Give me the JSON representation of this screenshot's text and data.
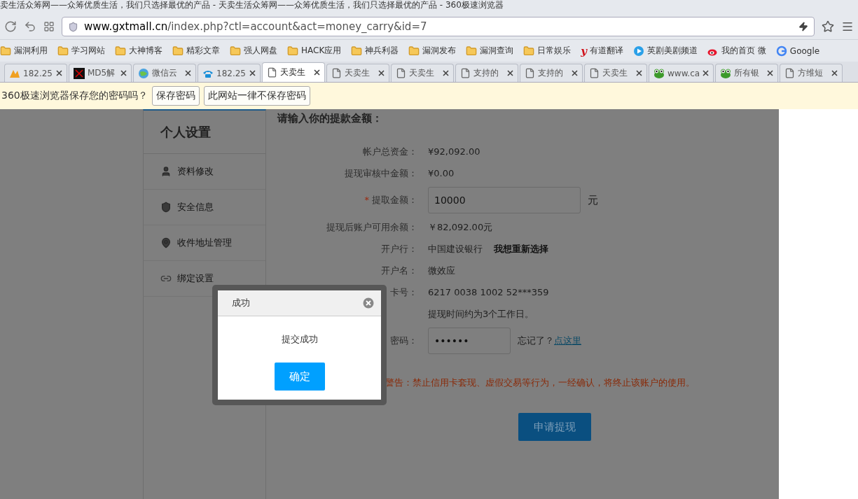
{
  "window": {
    "title": "卖生活众筹网——众筹优质生活，我们只选择最优的产品 - 天卖生活众筹网——众筹优质生活，我们只选择最优的产品 - 360极速浏览器"
  },
  "address_bar": {
    "host": "www.gxtmall.cn",
    "path": "/index.php?ctl=account&act=money_carry&id=7"
  },
  "bookmarks": [
    {
      "kind": "folder",
      "label": "漏洞利用"
    },
    {
      "kind": "folder",
      "label": "学习网站"
    },
    {
      "kind": "folder",
      "label": "大神博客"
    },
    {
      "kind": "folder",
      "label": "精彩文章"
    },
    {
      "kind": "folder",
      "label": "强人网盘"
    },
    {
      "kind": "folder",
      "label": "HACK应用"
    },
    {
      "kind": "folder",
      "label": "神兵利器"
    },
    {
      "kind": "folder",
      "label": "漏洞发布"
    },
    {
      "kind": "folder",
      "label": "漏洞查询"
    },
    {
      "kind": "folder",
      "label": "日常娱乐"
    },
    {
      "kind": "letter",
      "label": "有道翻译",
      "glyph": "y"
    },
    {
      "kind": "play",
      "label": "英剧美剧频道"
    },
    {
      "kind": "eye",
      "label": "我的首页 微"
    },
    {
      "kind": "google",
      "label": "Google"
    }
  ],
  "tabs": [
    {
      "kind": "chart",
      "label": "182.25",
      "selected": false
    },
    {
      "kind": "dark",
      "label": "MD5解",
      "selected": false
    },
    {
      "kind": "globe",
      "label": "微信云",
      "selected": false
    },
    {
      "kind": "phone",
      "label": "182.25",
      "selected": false
    },
    {
      "kind": "page",
      "label": "天卖生",
      "selected": true
    },
    {
      "kind": "page",
      "label": "天卖生",
      "selected": false
    },
    {
      "kind": "page",
      "label": "天卖生",
      "selected": false
    },
    {
      "kind": "page",
      "label": "支持的",
      "selected": false
    },
    {
      "kind": "page",
      "label": "支持的",
      "selected": false
    },
    {
      "kind": "page",
      "label": "天卖生",
      "selected": false
    },
    {
      "kind": "frog",
      "label": "www.ca",
      "selected": false
    },
    {
      "kind": "frog",
      "label": "所有银",
      "selected": false
    },
    {
      "kind": "page",
      "label": "方维短",
      "selected": false
    }
  ],
  "password_bar": {
    "message": "360极速浏览器保存您的密码吗？",
    "buttons": [
      "保存密码",
      "此网站一律不保存密码"
    ]
  },
  "sidebar": {
    "title": "个人设置",
    "items": [
      {
        "kind": "user",
        "label": "资料修改"
      },
      {
        "kind": "shield",
        "label": "安全信息"
      },
      {
        "kind": "pin",
        "label": "收件地址管理"
      },
      {
        "kind": "link",
        "label": "绑定设置"
      }
    ]
  },
  "form": {
    "heading": "请输入你的提款金额：",
    "rows": [
      {
        "kind": "text",
        "label": "帐户总资金：",
        "value": "¥92,092.00"
      },
      {
        "kind": "text",
        "label": "提现审核中金额：",
        "value": "¥0.00"
      },
      {
        "kind": "input",
        "label": "提取金额：",
        "mark": "*",
        "value": "10000",
        "unit": "元"
      },
      {
        "kind": "text",
        "label": "提现后账户可用余额：",
        "value": "￥82,092.00元"
      },
      {
        "kind": "bank",
        "label": "开户行：",
        "value": "中国建设银行",
        "link": "我想重新选择"
      },
      {
        "kind": "text",
        "label": "开户名：",
        "value": "微效应"
      },
      {
        "kind": "text",
        "label": "卡号：",
        "value": "6217 0038 1002 52***359"
      },
      {
        "kind": "note",
        "label": "",
        "value": "提现时间约为3个工作日。"
      },
      {
        "kind": "password",
        "label": "密码：",
        "value": "••••••",
        "hint": "忘记了？",
        "link": "点这里"
      }
    ],
    "warning": "警告：禁止信用卡套现、虚假交易等行为，一经确认，将终止该账户的使用。",
    "submit": "申请提现"
  },
  "dialog": {
    "title": "成功",
    "message": "提交成功",
    "button": "确定"
  }
}
